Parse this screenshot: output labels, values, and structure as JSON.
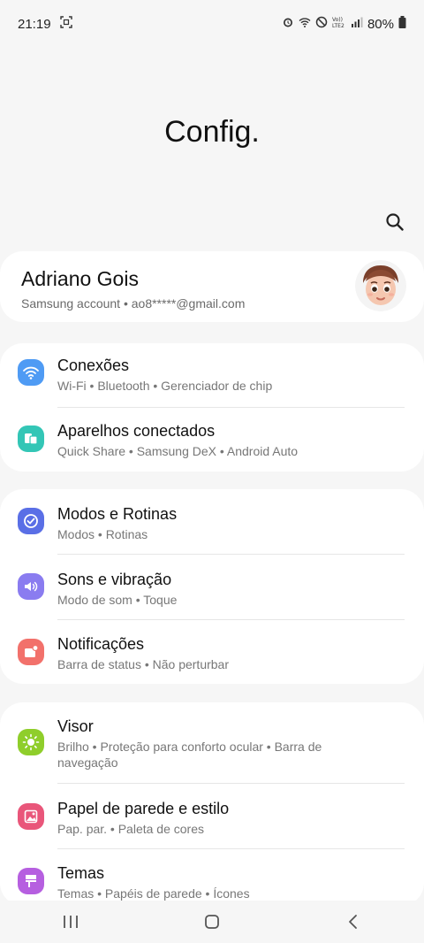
{
  "status_bar": {
    "time": "21:19",
    "battery": "80%"
  },
  "page": {
    "title": "Config."
  },
  "account": {
    "name": "Adriano Gois",
    "subtitle": "Samsung account  •  ao8*****@gmail.com"
  },
  "groups": [
    {
      "items": [
        {
          "title": "Conexões",
          "subtitle": "Wi-Fi  •  Bluetooth  •  Gerenciador de chip",
          "icon": "wifi-icon",
          "color": "#4f9bf4"
        },
        {
          "title": "Aparelhos conectados",
          "subtitle": "Quick Share  •  Samsung DeX  •  Android Auto",
          "icon": "devices-icon",
          "color": "#33c6b6"
        }
      ]
    },
    {
      "items": [
        {
          "title": "Modos e Rotinas",
          "subtitle": "Modos  •  Rotinas",
          "icon": "check-circle-icon",
          "color": "#5a6fe6"
        },
        {
          "title": "Sons e vibração",
          "subtitle": "Modo de som  •  Toque",
          "icon": "speaker-icon",
          "color": "#8a7cf0"
        },
        {
          "title": "Notificações",
          "subtitle": "Barra de status  •  Não perturbar",
          "icon": "notification-icon",
          "color": "#f2716b"
        }
      ]
    },
    {
      "items": [
        {
          "title": "Visor",
          "subtitle": "Brilho  •  Proteção para conforto ocular  •  Barra de navegação",
          "icon": "sun-icon",
          "color": "#8fce2b"
        },
        {
          "title": "Papel de parede e estilo",
          "subtitle": "Pap. par.  •  Paleta de cores",
          "icon": "image-icon",
          "color": "#e9567a"
        },
        {
          "title": "Temas",
          "subtitle": "Temas  •  Papéis de parede  •  Ícones",
          "icon": "brush-icon",
          "color": "#b65fe0"
        }
      ]
    }
  ],
  "nav": {
    "recent": "recents-icon",
    "home": "home-icon",
    "back": "back-icon"
  }
}
